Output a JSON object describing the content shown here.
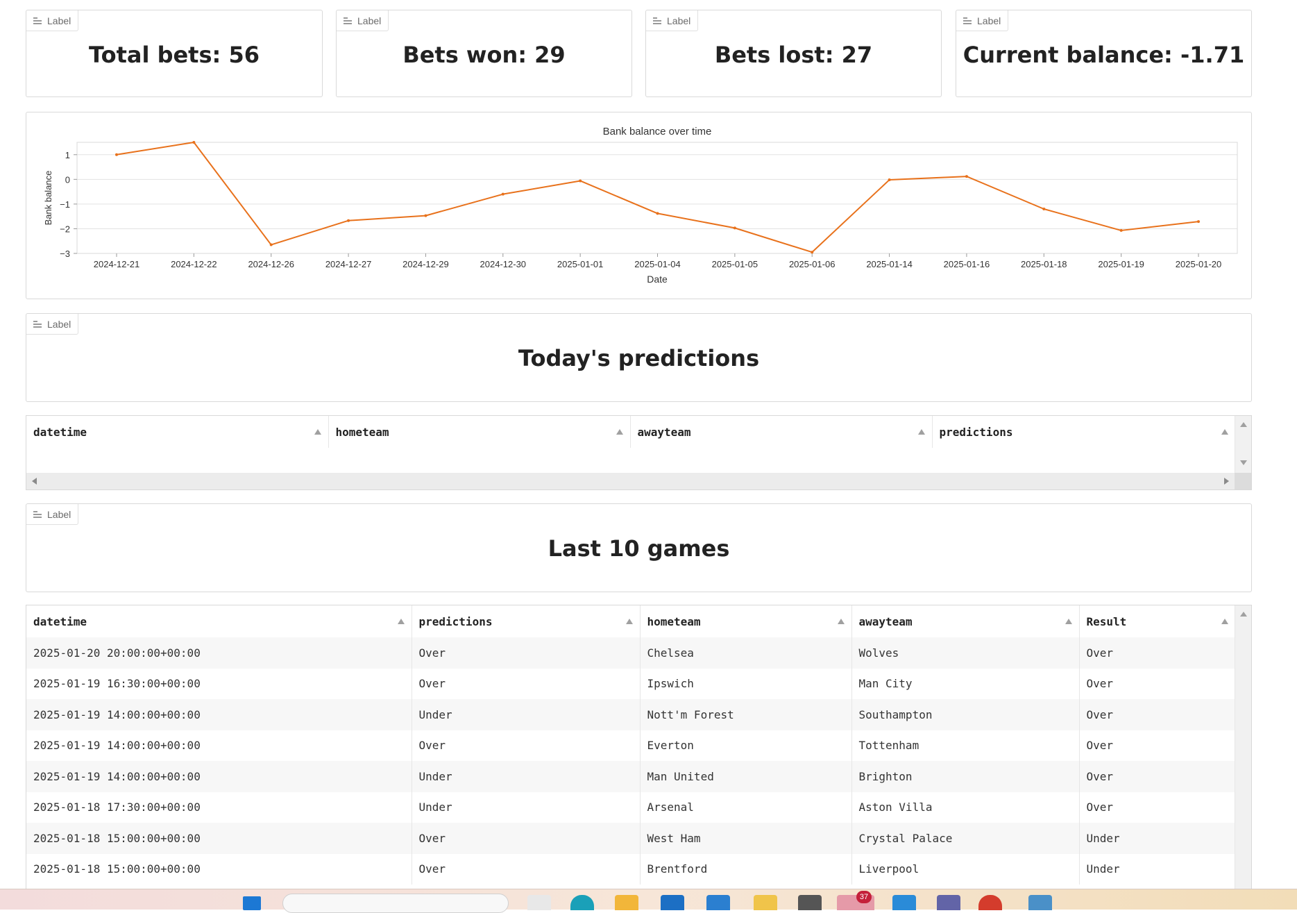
{
  "stats": {
    "tag_label": "Label",
    "total_bets": "Total bets: 56",
    "bets_won": "Bets won: 29",
    "bets_lost": "Bets lost: 27",
    "current_balance": "Current balance: -1.71"
  },
  "chart_data": {
    "type": "line",
    "title": "Bank balance over time",
    "xlabel": "Date",
    "ylabel": "Bank balance",
    "categories": [
      "2024-12-21",
      "2024-12-22",
      "2024-12-26",
      "2024-12-27",
      "2024-12-29",
      "2024-12-30",
      "2025-01-01",
      "2025-01-04",
      "2025-01-05",
      "2025-01-06",
      "2025-01-14",
      "2025-01-16",
      "2025-01-18",
      "2025-01-19",
      "2025-01-20"
    ],
    "values": [
      1.0,
      1.5,
      -2.65,
      -1.67,
      -1.47,
      -0.6,
      -0.06,
      -1.38,
      -1.97,
      -2.95,
      -0.02,
      0.12,
      -1.2,
      -2.07,
      -1.71
    ],
    "yticks": [
      1,
      0,
      -1,
      -2,
      -3
    ],
    "ylim": [
      -3,
      1.5
    ],
    "grid": true,
    "line_color": "#e8711b"
  },
  "predictions_section": {
    "tag_label": "Label",
    "title": "Today's predictions",
    "columns": [
      "datetime",
      "hometeam",
      "awayteam",
      "predictions"
    ]
  },
  "games_section": {
    "tag_label": "Label",
    "title": "Last 10 games",
    "columns": [
      "datetime",
      "predictions",
      "hometeam",
      "awayteam",
      "Result"
    ],
    "rows": [
      [
        "2025-01-20 20:00:00+00:00",
        "Over",
        "Chelsea",
        "Wolves",
        "Over"
      ],
      [
        "2025-01-19 16:30:00+00:00",
        "Over",
        "Ipswich",
        "Man City",
        "Over"
      ],
      [
        "2025-01-19 14:00:00+00:00",
        "Under",
        "Nott'm Forest",
        "Southampton",
        "Over"
      ],
      [
        "2025-01-19 14:00:00+00:00",
        "Over",
        "Everton",
        "Tottenham",
        "Over"
      ],
      [
        "2025-01-19 14:00:00+00:00",
        "Under",
        "Man United",
        "Brighton",
        "Over"
      ],
      [
        "2025-01-18 17:30:00+00:00",
        "Under",
        "Arsenal",
        "Aston Villa",
        "Over"
      ],
      [
        "2025-01-18 15:00:00+00:00",
        "Over",
        "West Ham",
        "Crystal Palace",
        "Under"
      ],
      [
        "2025-01-18 15:00:00+00:00",
        "Over",
        "Brentford",
        "Liverpool",
        "Under"
      ]
    ]
  },
  "taskbar": {
    "notification_badge": "37"
  }
}
